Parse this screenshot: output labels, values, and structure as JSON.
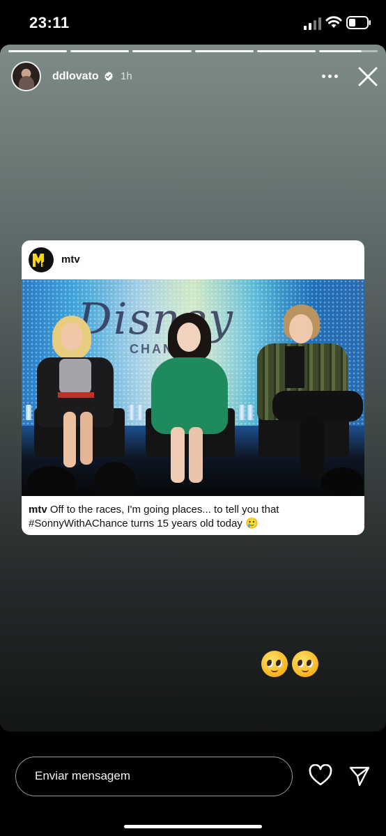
{
  "status_bar": {
    "time": "23:11"
  },
  "story": {
    "username": "ddlovato",
    "time_ago": "1h",
    "progress_segments": 6,
    "active_segment_fraction": 0.72
  },
  "shared_post": {
    "account": "mtv",
    "caption_user": "mtv",
    "caption_text": " Off to the races, I'm going places... to tell you that #SonnyWithAChance turns 15 years old today 🥲",
    "photo_backdrop_text": "Disney",
    "photo_backdrop_subtext": "CHANNEL"
  },
  "stickers": {
    "emojis": [
      "🥺",
      "🥺"
    ]
  },
  "reply_bar": {
    "placeholder": "Enviar mensagem"
  },
  "icons": {
    "signal": "signal-icon",
    "wifi": "wifi-icon",
    "battery": "battery-icon",
    "verified": "verified-badge-icon",
    "more": "more-options-icon",
    "close": "close-icon",
    "like": "heart-icon",
    "share": "send-icon"
  }
}
